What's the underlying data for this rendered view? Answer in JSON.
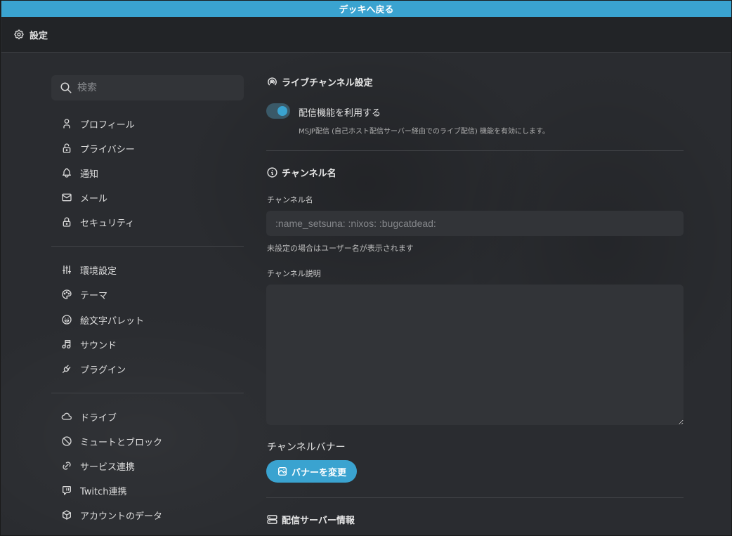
{
  "topbar": {
    "back_label": "デッキへ戻る"
  },
  "header": {
    "icon": "gear-icon",
    "title": "設定"
  },
  "sidebar": {
    "search_placeholder": "検索",
    "groups": [
      [
        {
          "icon": "user-icon",
          "label": "プロフィール"
        },
        {
          "icon": "lock-open-icon",
          "label": "プライバシー"
        },
        {
          "icon": "bell-icon",
          "label": "通知"
        },
        {
          "icon": "mail-icon",
          "label": "メール"
        },
        {
          "icon": "lock-icon",
          "label": "セキュリティ"
        }
      ],
      [
        {
          "icon": "adjustments-icon",
          "label": "環境設定"
        },
        {
          "icon": "palette-icon",
          "label": "テーマ"
        },
        {
          "icon": "mood-happy-icon",
          "label": "絵文字パレット"
        },
        {
          "icon": "music-icon",
          "label": "サウンド"
        },
        {
          "icon": "plug-icon",
          "label": "プラグイン"
        }
      ],
      [
        {
          "icon": "cloud-icon",
          "label": "ドライブ"
        },
        {
          "icon": "ban-icon",
          "label": "ミュートとブロック"
        },
        {
          "icon": "link-icon",
          "label": "サービス連携"
        },
        {
          "icon": "twitch-icon",
          "label": "Twitch連携"
        },
        {
          "icon": "package-icon",
          "label": "アカウントのデータ"
        }
      ]
    ]
  },
  "main": {
    "live_section": {
      "icon": "broadcast-icon",
      "title": "ライブチャンネル設定",
      "toggle_on": true,
      "toggle_label": "配信機能を利用する",
      "toggle_desc": "MSJP配信 (自己ホスト配信サーバー経由でのライブ配信) 機能を有効にします。"
    },
    "channel_section": {
      "icon": "info-circle-icon",
      "title": "チャンネル名",
      "name_label": "チャンネル名",
      "name_placeholder": ":name_setsuna: :nixos: :bugcatdead:",
      "name_hint": "未設定の場合はユーザー名が表示されます",
      "desc_label": "チャンネル説明",
      "desc_value": "",
      "banner_label": "チャンネルバナー",
      "banner_button_icon": "photo-icon",
      "banner_button": "バナーを変更"
    },
    "server_section": {
      "icon": "server-icon",
      "title": "配信サーバー情報"
    }
  },
  "colors": {
    "accent": "#3aa3d0",
    "background": "#2a2c30",
    "input": "#323438"
  }
}
